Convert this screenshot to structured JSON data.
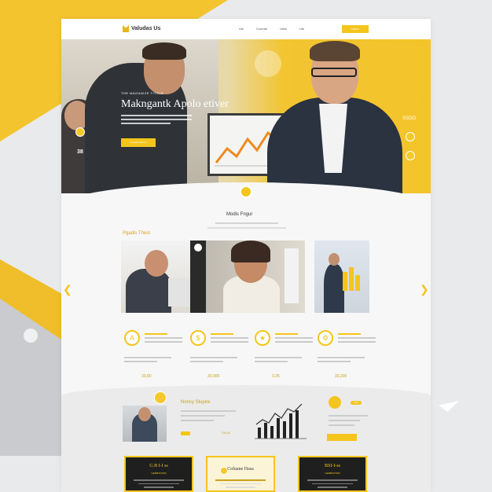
{
  "nav": {
    "logo_text": "Valudas Us",
    "links": [
      "Hio",
      "Conmte",
      "Utilio",
      "Uts"
    ],
    "cta_label": "Udon"
  },
  "hero": {
    "eyebrow": "THE MAGANIZE TITOLE",
    "title": "Makngantk Apolo etiver",
    "cta_label": "Lounges Mantry",
    "side_left": "38",
    "side_right": "SSOO"
  },
  "services": {
    "title": "Modis Fngur",
    "subtitle": "Pgadis Thest",
    "thumb_label": "Hs"
  },
  "features": [
    {
      "icon": "A",
      "value": "33,80"
    },
    {
      "icon": "$",
      "value": "33,900"
    },
    {
      "icon": "★",
      "value": "3,35"
    },
    {
      "icon": "⚙",
      "value": "33,200"
    }
  ],
  "lower": {
    "title": "Noncy Slupire",
    "value": "G0,00",
    "right_value": "20,0"
  },
  "cards": [
    {
      "title": "G.B I-I ss",
      "sub": "GEMBANTAM"
    },
    {
      "title": "Coluane Hasa",
      "sub": ""
    },
    {
      "title": "BSI-I-ss",
      "sub": "GEMBANTAM"
    }
  ],
  "colors": {
    "accent": "#f4c51d",
    "dark": "#1f1f1f",
    "page": "#f7f7f7"
  }
}
